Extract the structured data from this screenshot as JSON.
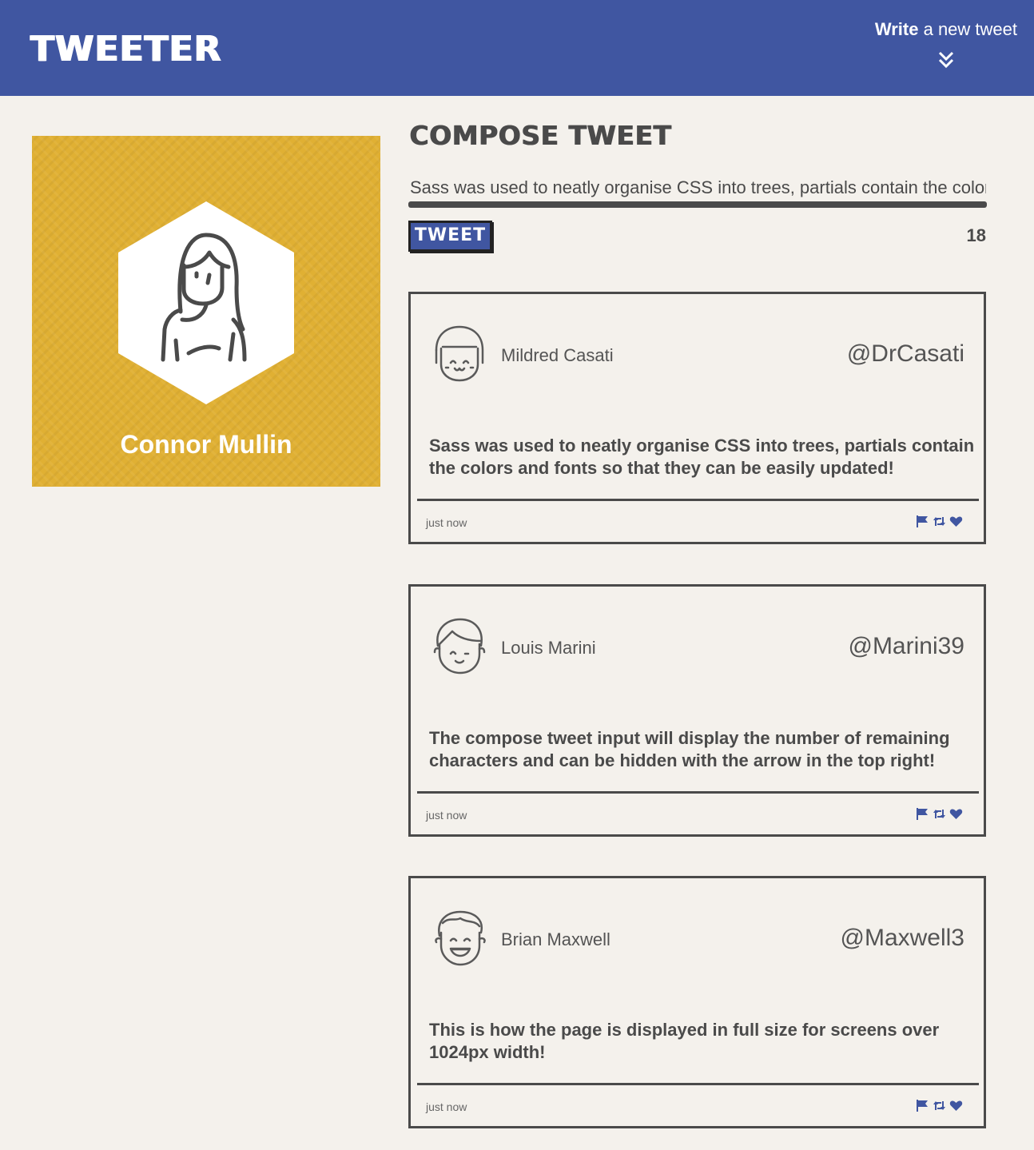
{
  "nav": {
    "brand": "TWEETER",
    "write_strong": "Write",
    "write_rest": " a new tweet",
    "toggle_icon": "double-chevron-down-icon"
  },
  "profile": {
    "name": "Connor Mullin",
    "avatar_icon": "woman-avatar-icon"
  },
  "compose": {
    "title": "COMPOSE TWEET",
    "input_value": "Sass was used to neatly organise CSS into trees, partials contain the colors",
    "button_label": "TWEET",
    "counter": "18"
  },
  "tweets": [
    {
      "name": "Mildred Casati",
      "handle": "@DrCasati",
      "body": "Sass was used to neatly organise CSS into trees, partials contain the colors and fonts so that they can be easily updated!",
      "time": "just now",
      "avatar_icon": "girl-avatar-icon"
    },
    {
      "name": "Louis Marini",
      "handle": "@Marini39",
      "body": "The compose tweet input will display the number of remaining characters and can be hidden with the arrow in the top right!",
      "time": "just now",
      "avatar_icon": "boy-avatar-icon"
    },
    {
      "name": "Brian Maxwell",
      "handle": "@Maxwell3",
      "body": "This is how the page is displayed in full size for screens over 1024px width!",
      "time": "just now",
      "avatar_icon": "laughing-man-avatar-icon"
    }
  ],
  "colors": {
    "nav": "#4056a1",
    "profile_bg": "#e0b033",
    "page_bg": "#f4f1ec",
    "text": "#4a4a4a"
  }
}
